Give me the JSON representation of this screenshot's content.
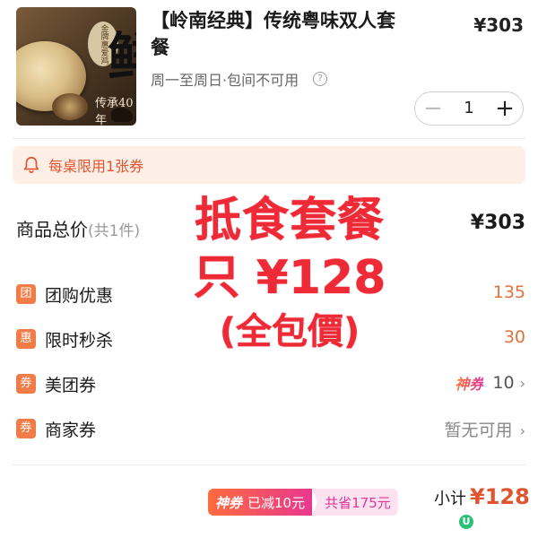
{
  "product": {
    "title": "【岭南经典】传统粤味双人套餐",
    "price": "¥303",
    "subtitle": "周一至周日·包间不可用",
    "image_text": {
      "badge": "金牌惠爱鸡",
      "big_char": "鲜",
      "heritage": "传承40年"
    }
  },
  "stepper": {
    "minus": "−",
    "quantity": "1",
    "plus": "+"
  },
  "coupon_notice": "每桌限用1张券",
  "total": {
    "label": "商品总价",
    "count": "(共1件)",
    "price": "¥303"
  },
  "discounts": [
    {
      "tag": "团",
      "label": "团购优惠",
      "value": "135"
    },
    {
      "tag": "惠",
      "label": "限时秒杀",
      "value": "30"
    },
    {
      "tag": "券",
      "label": "美团券",
      "badge": "神券",
      "value": "10"
    },
    {
      "tag": "券",
      "label": "商家券",
      "value": "暂无可用"
    }
  ],
  "promo": {
    "tag": "神券",
    "reduced": "已减10元",
    "saved": "共省175元"
  },
  "subtotal": {
    "label": "小计",
    "amount": "¥128"
  },
  "mini_badge": "U",
  "overlay": {
    "line1": "抵食套餐",
    "line2": "只 ¥128",
    "line3": "(全包價)"
  },
  "colors": {
    "accent": "#e0552f",
    "overlay_red": "#ef2a37",
    "tag_orange": "#f27c48",
    "notice_bg": "#fdeee6"
  }
}
